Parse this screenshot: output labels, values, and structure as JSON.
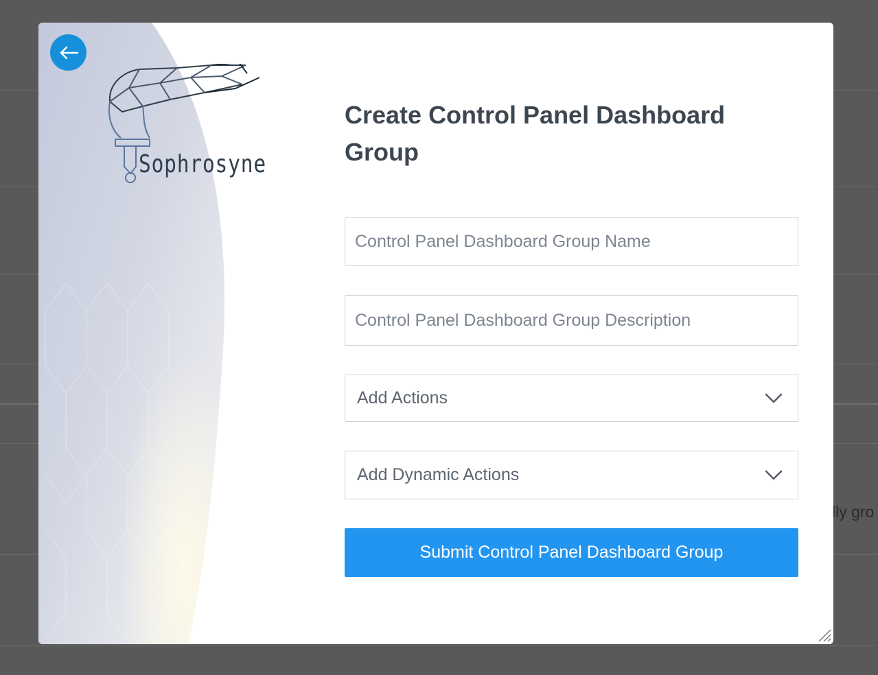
{
  "background": {
    "partial_text": "lly gro"
  },
  "modal": {
    "back_icon": "arrow-left-icon",
    "logo": {
      "text": "Sophrosyne"
    },
    "title": "Create Control Panel Dashboard Group",
    "fields": {
      "name_placeholder": "Control Panel Dashboard Group Name",
      "description_placeholder": "Control Panel Dashboard Group Description"
    },
    "selects": {
      "actions_label": "Add Actions",
      "dynamic_actions_label": "Add Dynamic Actions"
    },
    "submit_label": "Submit Control Panel Dashboard Group"
  },
  "colors": {
    "accent": "#2295f0",
    "back_button": "#1690db",
    "title": "#3d4650",
    "overlay": "#595959"
  }
}
